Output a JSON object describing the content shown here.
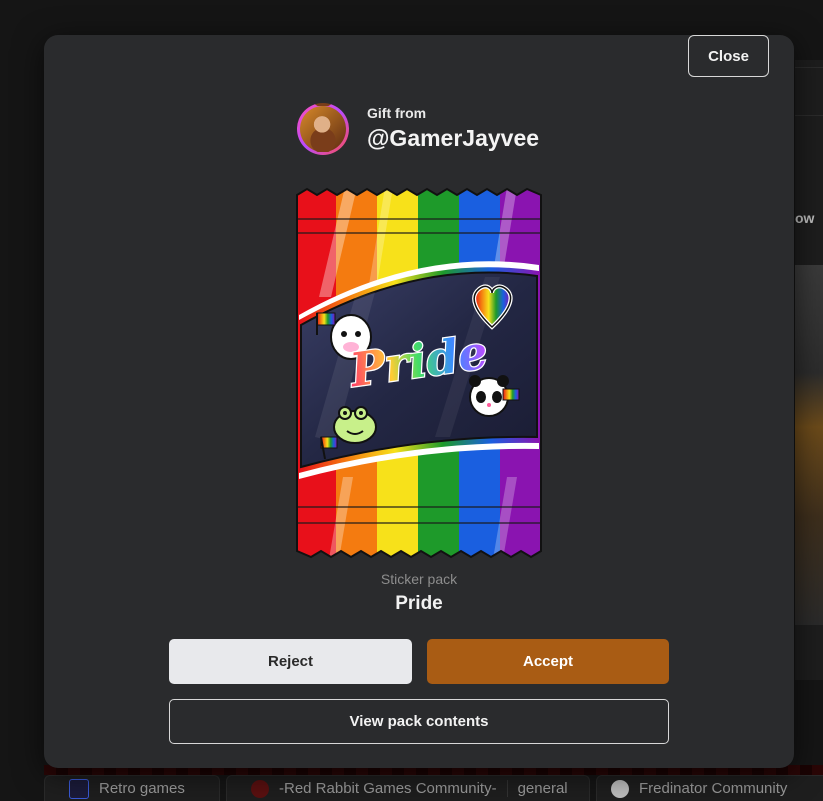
{
  "modal": {
    "close_label": "Close",
    "gift_from_label": "Gift from",
    "sender_username": "@GamerJayvee",
    "pack_type": "Sticker pack",
    "pack_name": "Pride",
    "pack_art_text": "Pride",
    "reject_label": "Reject",
    "accept_label": "Accept",
    "view_contents_label": "View pack contents"
  },
  "background": {
    "bottom_tabs": [
      {
        "label": "Retro games",
        "icon": "retro-games-icon"
      },
      {
        "label": "-Red Rabbit Games Community-",
        "sub": "general",
        "icon": "red-rabbit-icon"
      },
      {
        "label": "Fredinator Community",
        "icon": "fredinator-icon"
      }
    ],
    "side_text": "ow"
  },
  "colors": {
    "modal_bg": "#2a2b2d",
    "accept": "#a95c14",
    "reject": "#e8e9ec",
    "rainbow": [
      "#e8101a",
      "#f47b10",
      "#f7e11a",
      "#1e9a2a",
      "#1a5fe0",
      "#8a14b0"
    ]
  }
}
